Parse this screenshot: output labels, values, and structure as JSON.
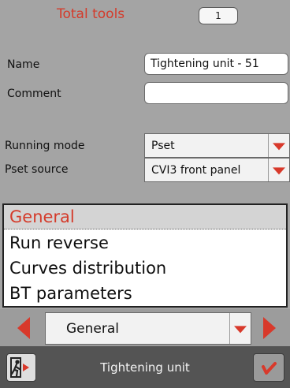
{
  "header": {
    "total_label": "Total tools",
    "total_value": "1"
  },
  "form": {
    "name_label": "Name",
    "name_value": "Tightening unit - 51",
    "comment_label": "Comment",
    "comment_value": "",
    "running_mode_label": "Running mode",
    "running_mode_value": "Pset",
    "pset_source_label": "Pset source",
    "pset_source_value": "CVI3 front panel"
  },
  "list": {
    "items": [
      {
        "label": "General",
        "selected": true
      },
      {
        "label": "Run reverse"
      },
      {
        "label": "Curves distribution"
      },
      {
        "label": "BT parameters"
      }
    ]
  },
  "nav": {
    "selected_value": "General"
  },
  "footer": {
    "title": "Tightening unit",
    "exit_icon": "exit-person-icon",
    "confirm_icon": "checkmark-icon"
  },
  "colors": {
    "accent": "#d8392b",
    "background": "#a4a4a4",
    "footer": "#545454"
  }
}
